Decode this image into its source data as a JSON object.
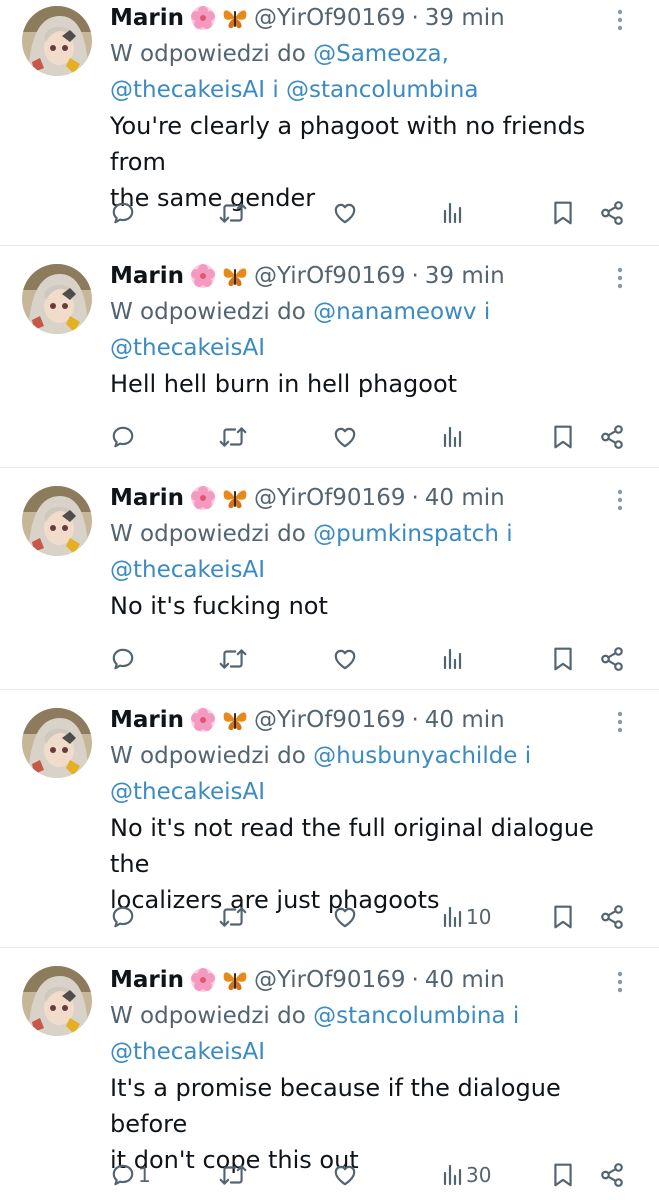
{
  "tweets": [
    {
      "name": "Marin",
      "handle": "@YirOf90169",
      "separator": "·",
      "time": "39 min",
      "reply_prefix": "W odpowiedzi do",
      "mention_1": "@Sameoza,",
      "mention_2": "@thecakeisAI",
      "conjunction": "i",
      "mention_3": "@stancolumbina",
      "text_line_1": "You're clearly a phagoot with no friends from",
      "text_line_2": "the same gender",
      "reply_count": "",
      "views_count": ""
    },
    {
      "name": "Marin",
      "handle": "@YirOf90169",
      "separator": "·",
      "time": "39 min",
      "reply_prefix": "W odpowiedzi do",
      "mention_1": "@nanameowv",
      "conjunction": "i",
      "mention_2": "@thecakeisAI",
      "text_line_1": "Hell hell burn in hell phagoot",
      "reply_count": "",
      "views_count": ""
    },
    {
      "name": "Marin",
      "handle": "@YirOf90169",
      "separator": "·",
      "time": "40 min",
      "reply_prefix": "W odpowiedzi do",
      "mention_1": "@pumkinspatch",
      "conjunction": "i",
      "mention_2": "@thecakeisAI",
      "text_line_1": "No it's fucking not",
      "reply_count": "",
      "views_count": ""
    },
    {
      "name": "Marin",
      "handle": "@YirOf90169",
      "separator": "·",
      "time": "40 min",
      "reply_prefix": "W odpowiedzi do",
      "mention_1": "@husbunyachilde",
      "conjunction": "i",
      "mention_2": "@thecakeisAI",
      "text_line_1": "No it's not read the full original dialogue the",
      "text_line_2": "localizers are just phagoots",
      "reply_count": "",
      "views_count": "10"
    },
    {
      "name": "Marin",
      "handle": "@YirOf90169",
      "separator": "·",
      "time": "40 min",
      "reply_prefix": "W odpowiedzi do",
      "mention_1": "@stancolumbina",
      "conjunction": "i",
      "mention_2": "@thecakeisAI",
      "text_line_1": "It's a promise because if the dialogue before",
      "text_line_2": "it don't cope this out",
      "reply_count": "1",
      "views_count": "30"
    }
  ],
  "icons": {
    "reply": "reply-icon",
    "retweet": "retweet-icon",
    "like": "heart-icon",
    "views": "views-chart-icon",
    "bookmark": "bookmark-icon",
    "share": "share-icon",
    "more": "more-dots-icon",
    "emoji_1": "cherry-blossom-icon",
    "emoji_2": "butterfly-icon"
  },
  "colors": {
    "text": "#0f1419",
    "secondary": "#536471",
    "mention": "#1d9bf0",
    "divider": "#e6e9ec"
  }
}
